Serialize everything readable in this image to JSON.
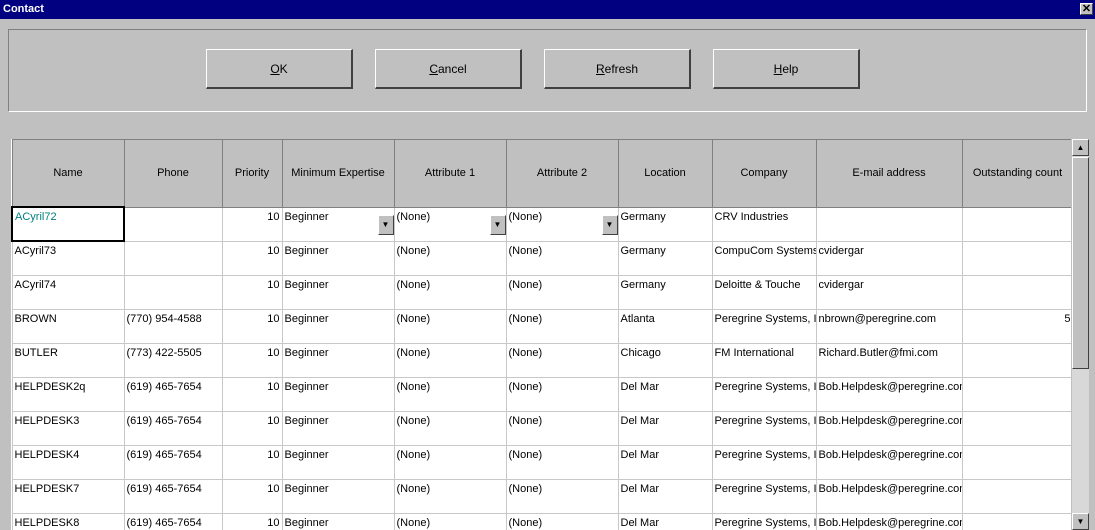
{
  "window": {
    "title": "Contact",
    "close_glyph": "✕"
  },
  "toolbar": {
    "ok": {
      "hotkey": "O",
      "rest": "K"
    },
    "cancel": {
      "hotkey": "C",
      "rest": "ancel"
    },
    "refresh": {
      "hotkey": "R",
      "rest": "efresh"
    },
    "help": {
      "hotkey": "H",
      "rest": "elp"
    }
  },
  "grid": {
    "columns": [
      "Name",
      "Phone",
      "Priority",
      "Minimum Expertise",
      "Attribute 1",
      "Attribute 2",
      "Location",
      "Company",
      "E-mail address",
      "Outstanding count"
    ],
    "rows": [
      [
        "ACyril72",
        "",
        "10",
        "Beginner",
        "(None)",
        "(None)",
        "Germany",
        "CRV Industries",
        "",
        ""
      ],
      [
        "ACyril73",
        "",
        "10",
        "Beginner",
        "(None)",
        "(None)",
        "Germany",
        "CompuCom Systems,",
        "cvidergar",
        ""
      ],
      [
        "ACyril74",
        "",
        "10",
        "Beginner",
        "(None)",
        "(None)",
        "Germany",
        "Deloitte & Touche",
        "cvidergar",
        ""
      ],
      [
        "BROWN",
        "(770) 954-4588",
        "10",
        "Beginner",
        "(None)",
        "(None)",
        "Atlanta",
        "Peregrine Systems, In",
        "nbrown@peregrine.com",
        "5"
      ],
      [
        "BUTLER",
        "(773) 422-5505",
        "10",
        "Beginner",
        "(None)",
        "(None)",
        "Chicago",
        "FM International",
        "Richard.Butler@fmi.com",
        ""
      ],
      [
        "HELPDESK2q",
        "(619) 465-7654",
        "10",
        "Beginner",
        "(None)",
        "(None)",
        "Del Mar",
        "Peregrine Systems, In",
        "Bob.Helpdesk@peregrine.com",
        ""
      ],
      [
        "HELPDESK3",
        "(619) 465-7654",
        "10",
        "Beginner",
        "(None)",
        "(None)",
        "Del Mar",
        "Peregrine Systems, In",
        "Bob.Helpdesk@peregrine.com",
        ""
      ],
      [
        "HELPDESK4",
        "(619) 465-7654",
        "10",
        "Beginner",
        "(None)",
        "(None)",
        "Del Mar",
        "Peregrine Systems, In",
        "Bob.Helpdesk@peregrine.com",
        ""
      ],
      [
        "HELPDESK7",
        "(619) 465-7654",
        "10",
        "Beginner",
        "(None)",
        "(None)",
        "Del Mar",
        "Peregrine Systems, In",
        "Bob.Helpdesk@peregrine.com",
        ""
      ],
      [
        "HELPDESK8",
        "(619) 465-7654",
        "10",
        "Beginner",
        "(None)",
        "(None)",
        "Del Mar",
        "Peregrine Systems, In",
        "Bob.Helpdesk@peregrine.com",
        ""
      ]
    ]
  },
  "colors": {
    "title_bar": "#000080",
    "selected_text": "#008080",
    "face": "#c0c0c0"
  }
}
